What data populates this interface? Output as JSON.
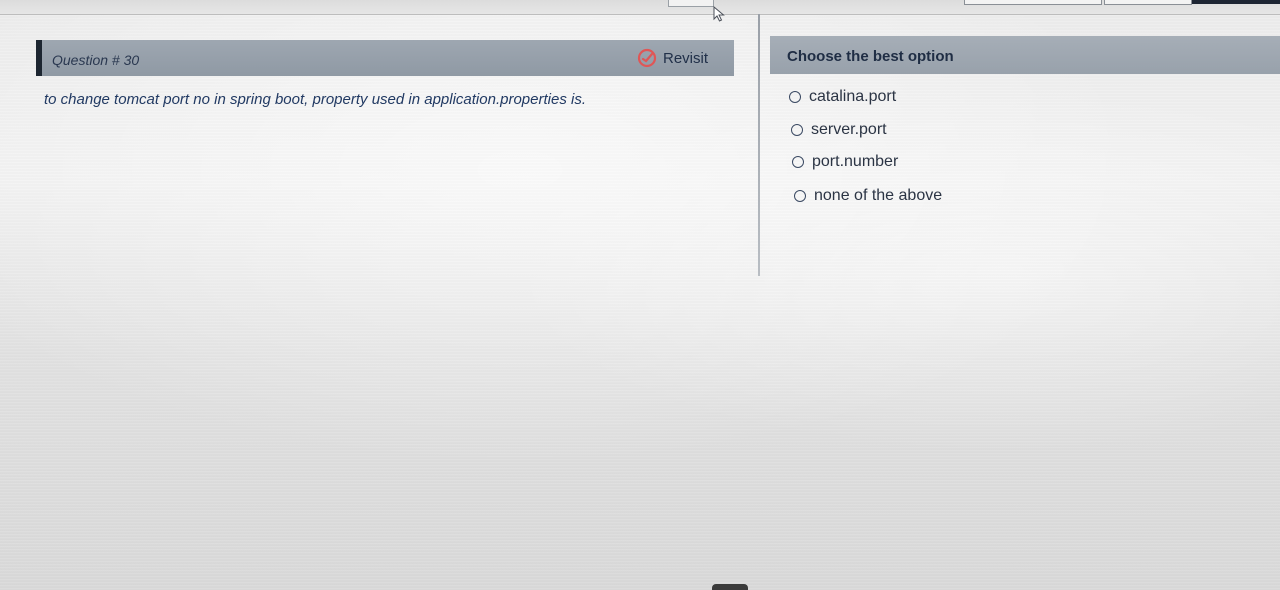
{
  "question": {
    "number_label": "Question # 30",
    "revisit_label": "Revisit",
    "text": "to change tomcat port no in spring boot, property used in application.properties is."
  },
  "options_panel": {
    "title": "Choose the best option",
    "options": [
      {
        "label": "catalina.port",
        "selected": false
      },
      {
        "label": "server.port",
        "selected": false
      },
      {
        "label": "port.number",
        "selected": false
      },
      {
        "label": "none of the above",
        "selected": false
      }
    ]
  },
  "colors": {
    "header_bg": "#969fa9",
    "header_accent": "#1d2631",
    "revisit_icon": "#e05656",
    "text": "#223a63"
  },
  "icons": {
    "revisit": "revisit-icon",
    "cursor": "mouse-cursor-icon",
    "radio": "radio-button"
  }
}
